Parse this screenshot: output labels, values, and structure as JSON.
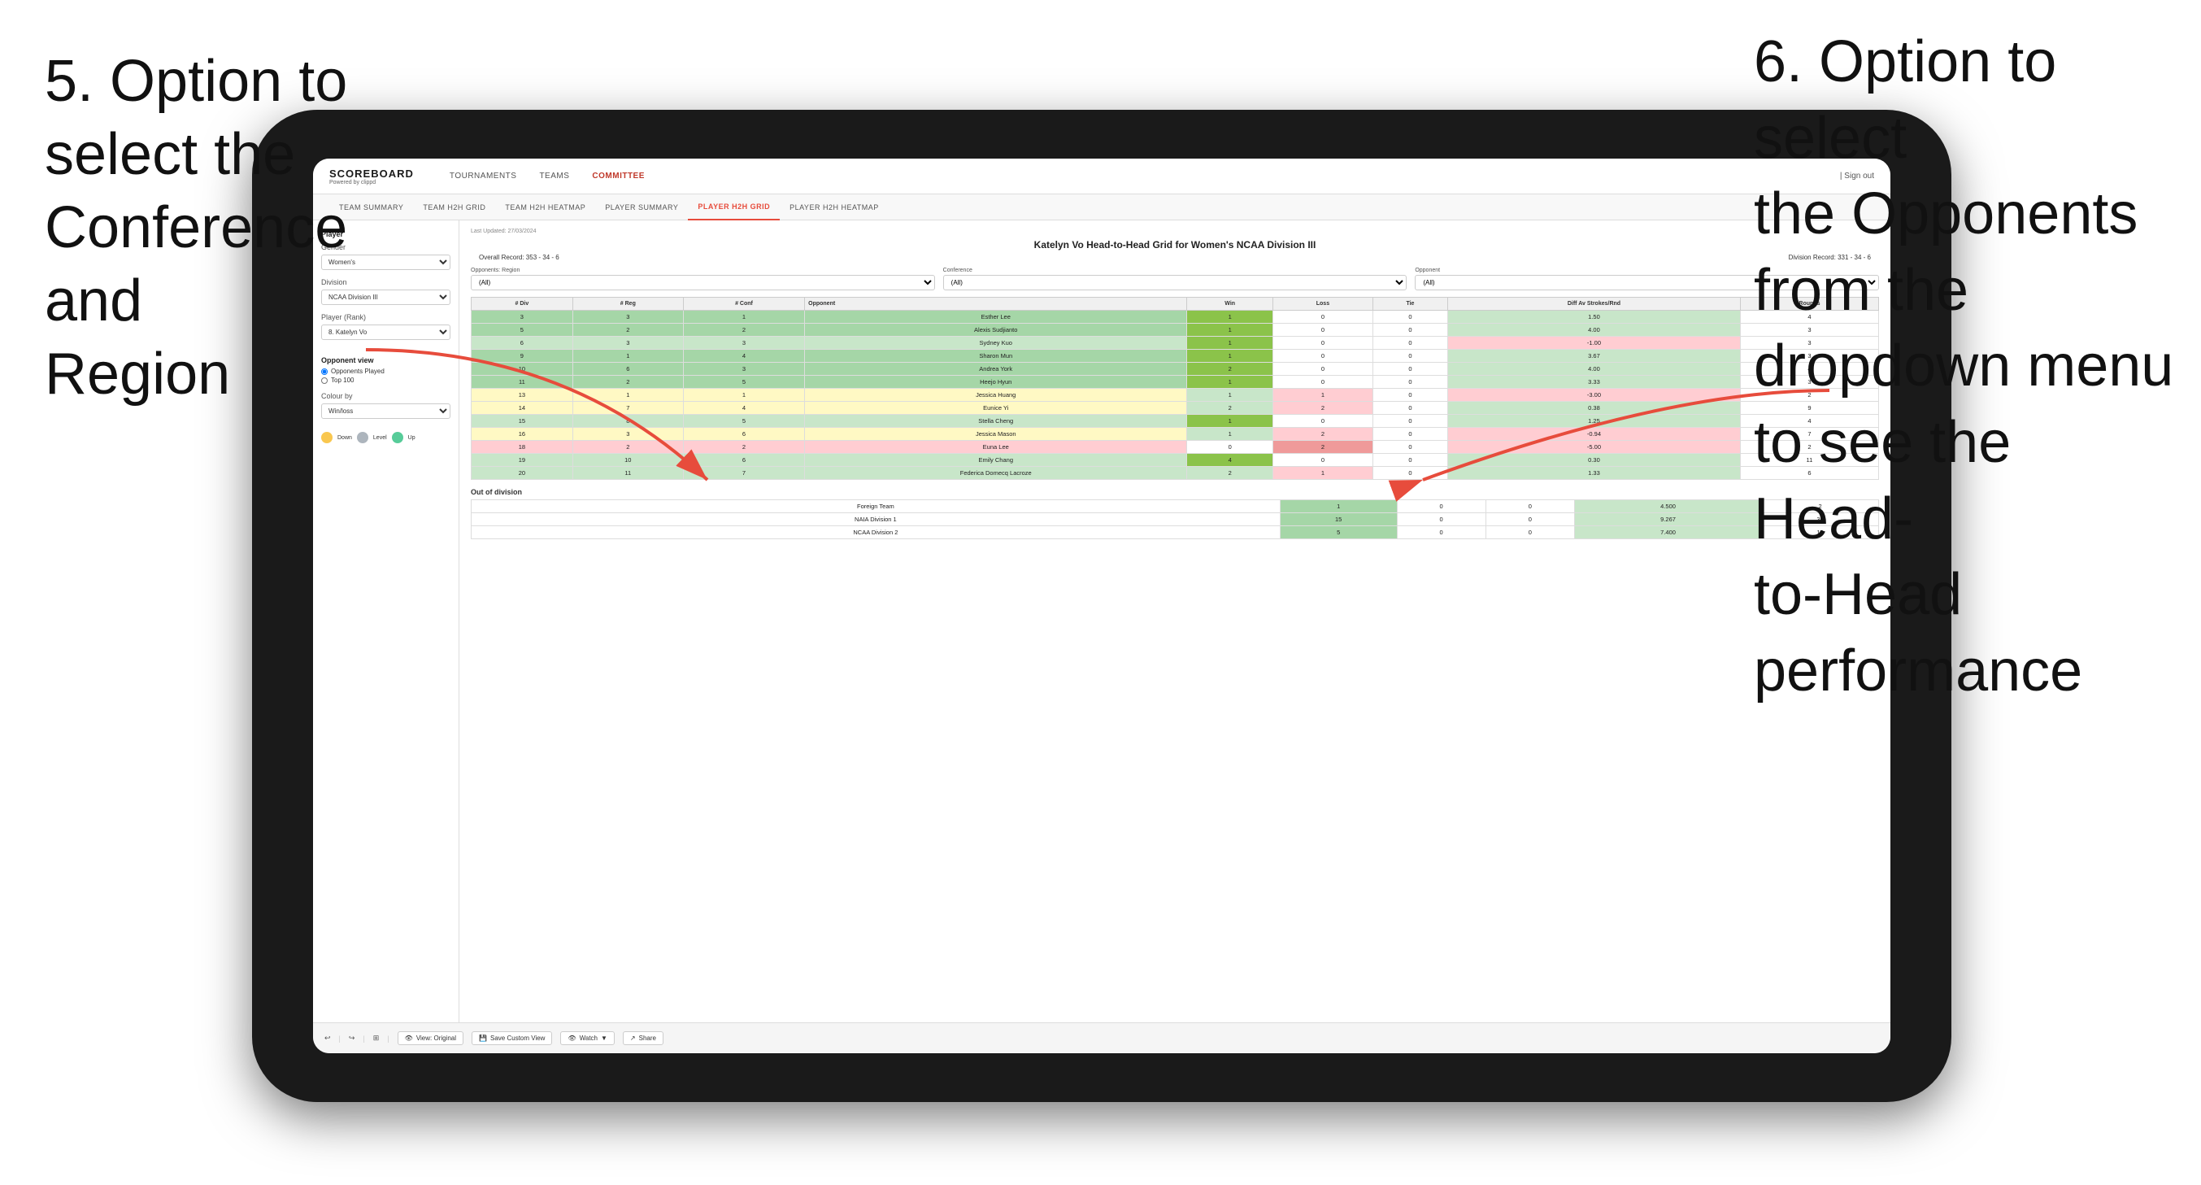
{
  "annotations": {
    "left": {
      "line1": "5. Option to",
      "line2": "select the",
      "line3": "Conference and",
      "line4": "Region"
    },
    "right": {
      "line1": "6. Option to select",
      "line2": "the Opponents",
      "line3": "from the",
      "line4": "dropdown menu",
      "line5": "to see the Head-",
      "line6": "to-Head",
      "line7": "performance"
    }
  },
  "header": {
    "logo": "SCOREBOARD",
    "logo_sub": "Powered by clippd",
    "nav": [
      "TOURNAMENTS",
      "TEAMS",
      "COMMITTEE"
    ],
    "sign_out": "Sign out"
  },
  "subnav": {
    "items": [
      "TEAM SUMMARY",
      "TEAM H2H GRID",
      "TEAM H2H HEATMAP",
      "PLAYER SUMMARY",
      "PLAYER H2H GRID",
      "PLAYER H2H HEATMAP"
    ]
  },
  "sidebar": {
    "player_label": "Player",
    "gender_label": "Gender",
    "gender_value": "Women's",
    "division_label": "Division",
    "division_value": "NCAA Division III",
    "player_rank_label": "Player (Rank)",
    "player_rank_value": "8. Katelyn Vo",
    "opponent_view_label": "Opponent view",
    "radio1": "Opponents Played",
    "radio2": "Top 100",
    "colour_by_label": "Colour by",
    "colour_value": "Win/loss",
    "legend": [
      {
        "color": "#f9c74f",
        "label": "Down"
      },
      {
        "color": "#adb5bd",
        "label": "Level"
      },
      {
        "color": "#57cc99",
        "label": "Up"
      }
    ]
  },
  "content": {
    "last_updated": "Last Updated: 27/03/2024",
    "title": "Katelyn Vo Head-to-Head Grid for Women's NCAA Division III",
    "overall_record": "Overall Record: 353 - 34 - 6",
    "division_record": "Division Record: 331 - 34 - 6",
    "filters": {
      "region_label": "Region",
      "region_value": "(All)",
      "opponents_label": "Opponents:",
      "conference_label": "Conference",
      "conference_value": "(All)",
      "opponent_label": "Opponent",
      "opponent_value": "(All)"
    },
    "table_headers": [
      "# Div",
      "# Reg",
      "# Conf",
      "Opponent",
      "Win",
      "Loss",
      "Tie",
      "Diff Av Strokes/Rnd",
      "Rounds"
    ],
    "rows": [
      {
        "div": 3,
        "reg": 3,
        "conf": 1,
        "opponent": "Esther Lee",
        "win": 1,
        "loss": 0,
        "tie": 0,
        "diff": 1.5,
        "rounds": 4,
        "color": "green-med"
      },
      {
        "div": 5,
        "reg": 2,
        "conf": 2,
        "opponent": "Alexis Sudjianto",
        "win": 1,
        "loss": 0,
        "tie": 0,
        "diff": 4.0,
        "rounds": 3,
        "color": "green-med"
      },
      {
        "div": 6,
        "reg": 3,
        "conf": 3,
        "opponent": "Sydney Kuo",
        "win": 1,
        "loss": 0,
        "tie": 0,
        "diff": -1.0,
        "rounds": 3,
        "color": "green-light"
      },
      {
        "div": 9,
        "reg": 1,
        "conf": 4,
        "opponent": "Sharon Mun",
        "win": 1,
        "loss": 0,
        "tie": 0,
        "diff": 3.67,
        "rounds": 3,
        "color": "green-med"
      },
      {
        "div": 10,
        "reg": 6,
        "conf": 3,
        "opponent": "Andrea York",
        "win": 2,
        "loss": 0,
        "tie": 0,
        "diff": 4.0,
        "rounds": 4,
        "color": "green-med"
      },
      {
        "div": 11,
        "reg": 2,
        "conf": 5,
        "opponent": "Heejo Hyun",
        "win": 1,
        "loss": 0,
        "tie": 0,
        "diff": 3.33,
        "rounds": 3,
        "color": "green-med"
      },
      {
        "div": 13,
        "reg": 1,
        "conf": 1,
        "opponent": "Jessica Huang",
        "win": 1,
        "loss": 1,
        "tie": 0,
        "diff": -3.0,
        "rounds": 2,
        "color": "yellow"
      },
      {
        "div": 14,
        "reg": 7,
        "conf": 4,
        "opponent": "Eunice Yi",
        "win": 2,
        "loss": 2,
        "tie": 0,
        "diff": 0.38,
        "rounds": 9,
        "color": "yellow"
      },
      {
        "div": 15,
        "reg": 8,
        "conf": 5,
        "opponent": "Stella Cheng",
        "win": 1,
        "loss": 0,
        "tie": 0,
        "diff": 1.25,
        "rounds": 4,
        "color": "green-light"
      },
      {
        "div": 16,
        "reg": 3,
        "conf": 6,
        "opponent": "Jessica Mason",
        "win": 1,
        "loss": 2,
        "tie": 0,
        "diff": -0.94,
        "rounds": 7,
        "color": "yellow"
      },
      {
        "div": 18,
        "reg": 2,
        "conf": 2,
        "opponent": "Euna Lee",
        "win": 0,
        "loss": 2,
        "tie": 0,
        "diff": -5.0,
        "rounds": 2,
        "color": "orange-light"
      },
      {
        "div": 19,
        "reg": 10,
        "conf": 6,
        "opponent": "Emily Chang",
        "win": 4,
        "loss": 0,
        "tie": 0,
        "diff": 0.3,
        "rounds": 11,
        "color": "green-light"
      },
      {
        "div": 20,
        "reg": 11,
        "conf": 7,
        "opponent": "Federica Domecq Lacroze",
        "win": 2,
        "loss": 1,
        "tie": 0,
        "diff": 1.33,
        "rounds": 6,
        "color": "green-light"
      }
    ],
    "out_of_division_label": "Out of division",
    "out_rows": [
      {
        "label": "Foreign Team",
        "win": 1,
        "loss": 0,
        "tie": 0,
        "diff": 4.5,
        "rounds": 2
      },
      {
        "label": "NAIA Division 1",
        "win": 15,
        "loss": 0,
        "tie": 0,
        "diff": 9.267,
        "rounds": 30
      },
      {
        "label": "NCAA Division 2",
        "win": 5,
        "loss": 0,
        "tie": 0,
        "diff": 7.4,
        "rounds": 10
      }
    ]
  },
  "toolbar": {
    "view_original": "View: Original",
    "save_custom": "Save Custom View",
    "watch": "Watch",
    "share": "Share"
  }
}
